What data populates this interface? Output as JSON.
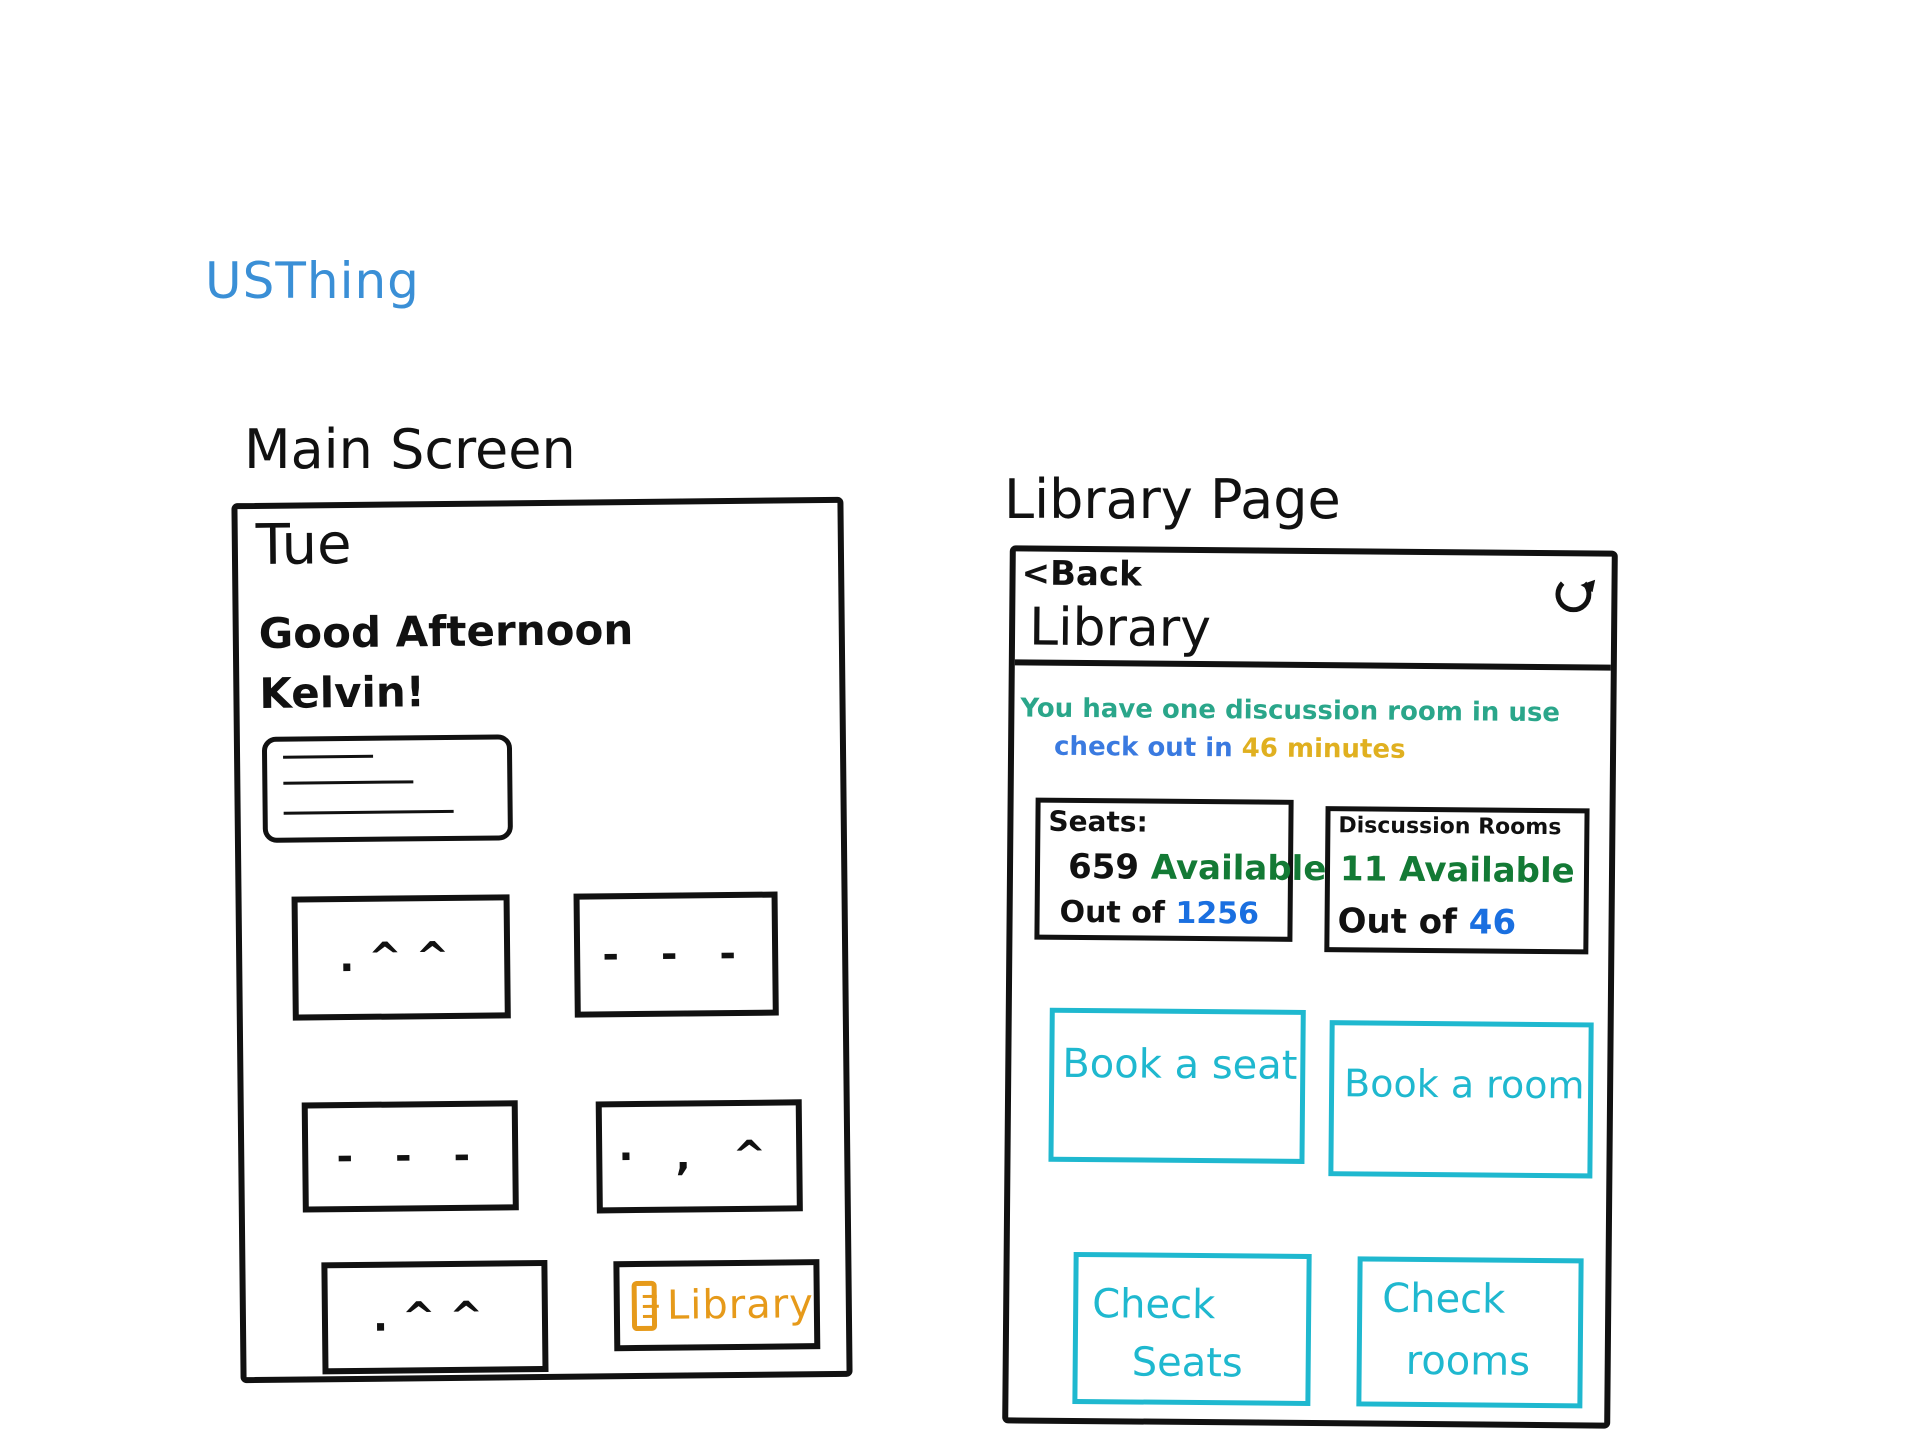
{
  "app_title": "USThing",
  "main_screen": {
    "title": "Main Screen",
    "day": "Tue",
    "greeting_line1": "Good Afternoon",
    "greeting_line2": "Kelvin!",
    "tiles": [
      ".^^",
      "- - -",
      "- - -",
      "· , ^",
      ".^^"
    ],
    "library_tile_label": "Library"
  },
  "library_page": {
    "title": "Library Page",
    "back_label": "<Back",
    "heading": "Library",
    "message_line1": "You have one discussion room in use",
    "message_line2_prefix": "check out in",
    "message_line2_minutes": "46 minutes",
    "seats": {
      "label": "Seats:",
      "available": "659",
      "available_word": "Available",
      "out_of_prefix": "Out of",
      "total": "1256"
    },
    "rooms": {
      "label": "Discussion Rooms",
      "available": "11",
      "available_word": "Available",
      "out_of_prefix": "Out of",
      "total": "46"
    },
    "actions": {
      "book_seat": "Book a seat",
      "book_room": "Book a room",
      "check_seats_line1": "Check",
      "check_seats_line2": "Seats",
      "check_rooms_line1": "Check",
      "check_rooms_line2": "rooms"
    }
  },
  "colors": {
    "app_title": "#3a8fd6",
    "library_tile": "#e69a1a",
    "message": "#2aa68a",
    "checkout": "#3a7ae0",
    "minutes": "#e0b020",
    "available": "#137a35",
    "total": "#1a6fe0",
    "action": "#1fb8cf"
  }
}
